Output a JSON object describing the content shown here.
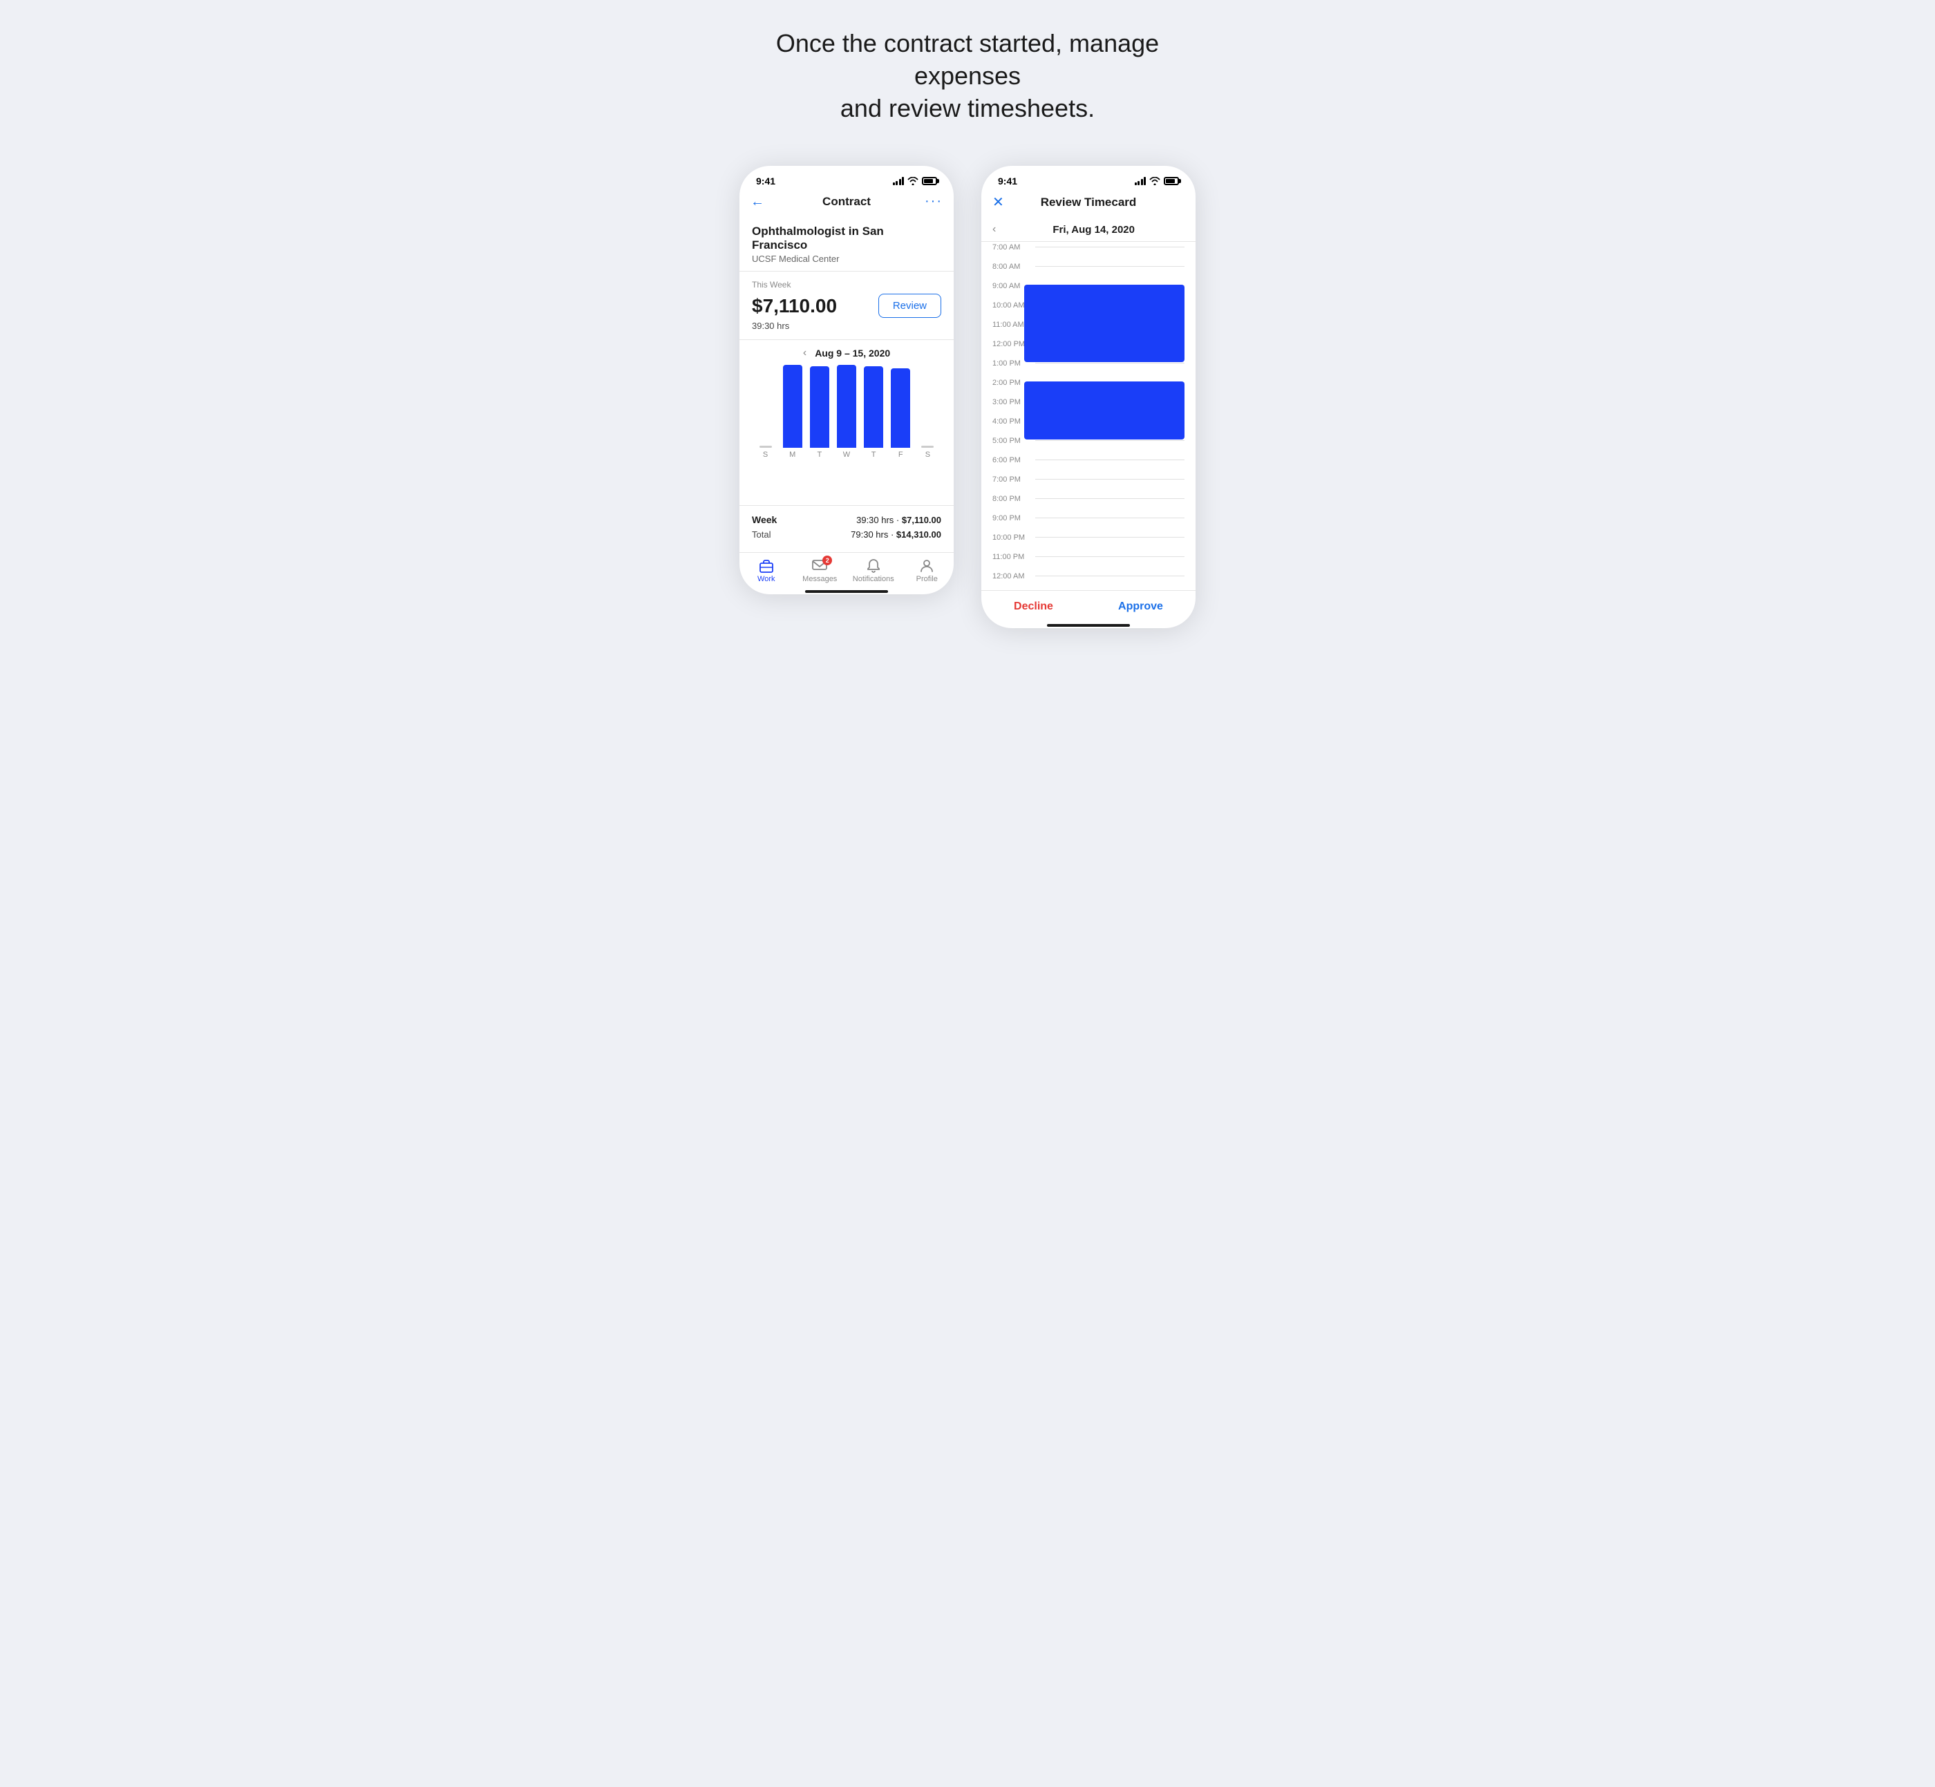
{
  "headline": {
    "line1": "Once the contract started, manage expenses",
    "line2": "and review timesheets."
  },
  "phone1": {
    "status": {
      "time": "9:41"
    },
    "nav": {
      "title": "Contract",
      "back_label": "←",
      "more_label": "···"
    },
    "contract": {
      "title": "Ophthalmologist in San Francisco",
      "subtitle": "UCSF Medical Center"
    },
    "week": {
      "label": "This Week",
      "amount": "$7,110.00",
      "hours": "39:30 hrs",
      "review_btn": "Review"
    },
    "chart": {
      "period": "Aug 9 – 15, 2020",
      "days": [
        "S",
        "M",
        "T",
        "W",
        "T",
        "F",
        "S"
      ],
      "heights": [
        0,
        120,
        118,
        120,
        118,
        115,
        0
      ]
    },
    "summary": {
      "week_label": "Week",
      "week_value": "39:30 hrs · $7,110.00",
      "total_label": "Total",
      "total_value": "79:30 hrs · $14,310.00"
    },
    "tabs": [
      {
        "id": "work",
        "label": "Work",
        "active": true
      },
      {
        "id": "messages",
        "label": "Messages",
        "badge": "2"
      },
      {
        "id": "notifications",
        "label": "Notifications",
        "badge": null
      },
      {
        "id": "profile",
        "label": "Profile",
        "badge": null
      }
    ]
  },
  "phone2": {
    "status": {
      "time": "9:41"
    },
    "nav": {
      "title": "Review Timecard",
      "close_label": "✕"
    },
    "date": "Fri, Aug 14, 2020",
    "times": [
      "7:00 AM",
      "8:00 AM",
      "9:00 AM",
      "10:00 AM",
      "11:00 AM",
      "12:00 PM",
      "1:00 PM",
      "2:00 PM",
      "3:00 PM",
      "4:00 PM",
      "5:00 PM",
      "6:00 PM",
      "7:00 PM",
      "8:00 PM",
      "9:00 PM",
      "10:00 PM",
      "11:00 PM",
      "12:00 AM"
    ],
    "blocks": [
      {
        "start_index": 2,
        "end_index": 6,
        "label": "9AM-1PM"
      },
      {
        "start_index": 7,
        "end_index": 10,
        "label": "2PM-5PM"
      }
    ],
    "actions": {
      "decline": "Decline",
      "approve": "Approve"
    }
  }
}
